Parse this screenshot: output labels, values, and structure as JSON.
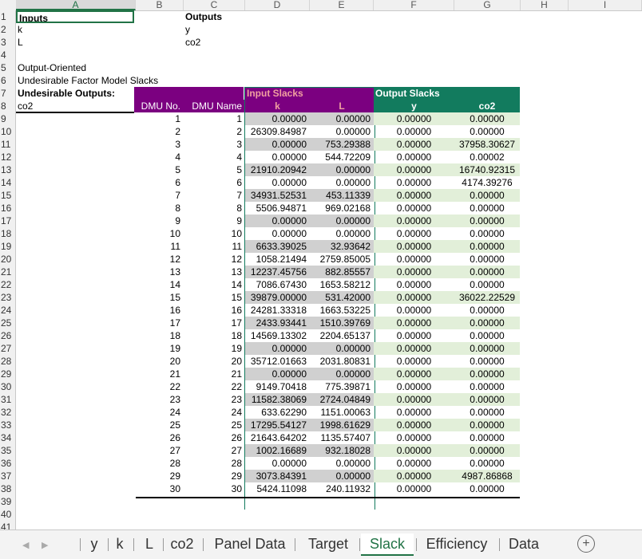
{
  "columns": [
    "A",
    "B",
    "C",
    "D",
    "E",
    "F",
    "G",
    "H",
    "I"
  ],
  "header": {
    "inputs_label": "Inputs",
    "outputs_label": "Outputs",
    "input_k": "k",
    "input_L": "L",
    "output_y": "y",
    "output_co2": "co2",
    "model_line1": "Output-Oriented",
    "model_line2": "Undesirable Factor Model Slacks",
    "undesirable_label": "Undesirable Outputs:",
    "undesirable_item": "co2",
    "input_slacks": "Input Slacks",
    "output_slacks": "Output Slacks",
    "dmu_no": "DMU No.",
    "dmu_name": "DMU Name",
    "col_k": "k",
    "col_L": "L",
    "col_y": "y",
    "col_co2": "co2"
  },
  "rows": [
    [
      "1",
      "1",
      "0.00000",
      "0.00000",
      "0.00000",
      "0.00000"
    ],
    [
      "2",
      "2",
      "26309.84987",
      "0.00000",
      "0.00000",
      "0.00000"
    ],
    [
      "3",
      "3",
      "0.00000",
      "753.29388",
      "0.00000",
      "37958.30627"
    ],
    [
      "4",
      "4",
      "0.00000",
      "544.72209",
      "0.00000",
      "0.00002"
    ],
    [
      "5",
      "5",
      "21910.20942",
      "0.00000",
      "0.00000",
      "16740.92315"
    ],
    [
      "6",
      "6",
      "0.00000",
      "0.00000",
      "0.00000",
      "4174.39276"
    ],
    [
      "7",
      "7",
      "34931.52531",
      "453.11339",
      "0.00000",
      "0.00000"
    ],
    [
      "8",
      "8",
      "5506.94871",
      "969.02168",
      "0.00000",
      "0.00000"
    ],
    [
      "9",
      "9",
      "0.00000",
      "0.00000",
      "0.00000",
      "0.00000"
    ],
    [
      "10",
      "10",
      "0.00000",
      "0.00000",
      "0.00000",
      "0.00000"
    ],
    [
      "11",
      "11",
      "6633.39025",
      "32.93642",
      "0.00000",
      "0.00000"
    ],
    [
      "12",
      "12",
      "1058.21494",
      "2759.85005",
      "0.00000",
      "0.00000"
    ],
    [
      "13",
      "13",
      "12237.45756",
      "882.85557",
      "0.00000",
      "0.00000"
    ],
    [
      "14",
      "14",
      "7086.67430",
      "1653.58212",
      "0.00000",
      "0.00000"
    ],
    [
      "15",
      "15",
      "39879.00000",
      "531.42000",
      "0.00000",
      "36022.22529"
    ],
    [
      "16",
      "16",
      "24281.33318",
      "1663.53225",
      "0.00000",
      "0.00000"
    ],
    [
      "17",
      "17",
      "2433.93441",
      "1510.39769",
      "0.00000",
      "0.00000"
    ],
    [
      "18",
      "18",
      "14569.13302",
      "2204.65137",
      "0.00000",
      "0.00000"
    ],
    [
      "19",
      "19",
      "0.00000",
      "0.00000",
      "0.00000",
      "0.00000"
    ],
    [
      "20",
      "20",
      "35712.01663",
      "2031.80831",
      "0.00000",
      "0.00000"
    ],
    [
      "21",
      "21",
      "0.00000",
      "0.00000",
      "0.00000",
      "0.00000"
    ],
    [
      "22",
      "22",
      "9149.70418",
      "775.39871",
      "0.00000",
      "0.00000"
    ],
    [
      "23",
      "23",
      "11582.38069",
      "2724.04849",
      "0.00000",
      "0.00000"
    ],
    [
      "24",
      "24",
      "633.62290",
      "1151.00063",
      "0.00000",
      "0.00000"
    ],
    [
      "25",
      "25",
      "17295.54127",
      "1998.61629",
      "0.00000",
      "0.00000"
    ],
    [
      "26",
      "26",
      "21643.64202",
      "1135.57407",
      "0.00000",
      "0.00000"
    ],
    [
      "27",
      "27",
      "1002.16689",
      "932.18028",
      "0.00000",
      "0.00000"
    ],
    [
      "28",
      "28",
      "0.00000",
      "0.00000",
      "0.00000",
      "0.00000"
    ],
    [
      "29",
      "29",
      "3073.84391",
      "0.00000",
      "0.00000",
      "4987.86868"
    ],
    [
      "30",
      "30",
      "5424.11098",
      "240.11932",
      "0.00000",
      "0.00000"
    ]
  ],
  "row_numbers": [
    "1",
    "2",
    "3",
    "4",
    "5",
    "6",
    "7",
    "8",
    "9",
    "10",
    "11",
    "12",
    "13",
    "14",
    "15",
    "16",
    "17",
    "18",
    "19",
    "20",
    "21",
    "22",
    "23",
    "24",
    "25",
    "26",
    "27",
    "28",
    "29",
    "30",
    "31",
    "32",
    "33",
    "34",
    "35",
    "36",
    "37",
    "38",
    "39",
    "40",
    "41"
  ],
  "sheets": [
    "y",
    "k",
    "L",
    "co2",
    "Panel Data",
    "Target",
    "Slack",
    "Efficiency",
    "Data"
  ],
  "active_sheet": "Slack",
  "colors": {
    "purple": "#7b0080",
    "green_header": "#127b5e",
    "grey_band": "#d0d0d0",
    "green_band": "#e2efd9",
    "excel_green": "#217346"
  }
}
